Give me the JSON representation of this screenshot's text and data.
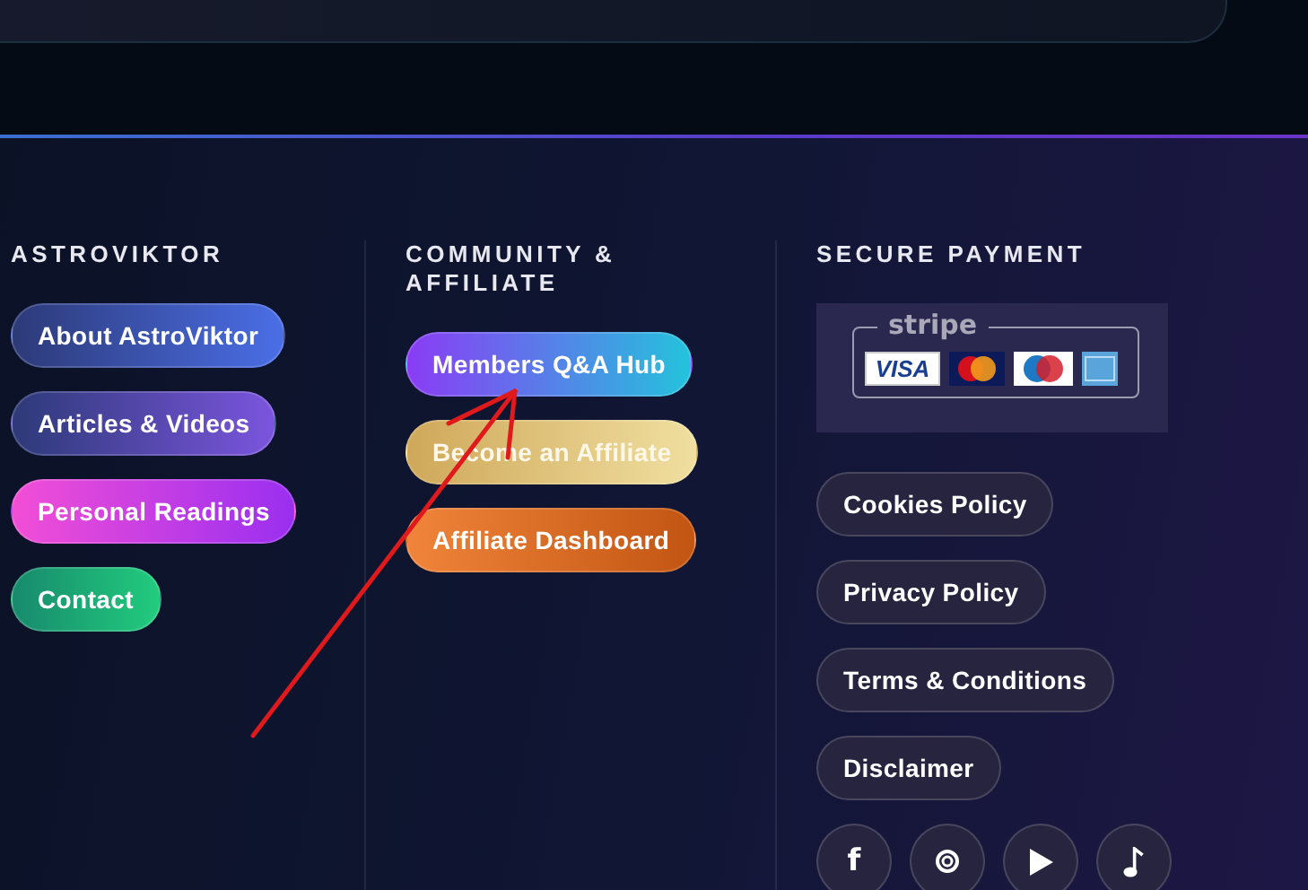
{
  "columns": [
    {
      "heading": "ASTROVIKTOR",
      "links": [
        {
          "label": "About AstroViktor",
          "kind": "blue"
        },
        {
          "label": "Articles & Videos",
          "kind": "violet"
        },
        {
          "label": "Personal Readings",
          "kind": "pink"
        },
        {
          "label": "Contact",
          "kind": "green"
        }
      ]
    },
    {
      "heading": "COMMUNITY & AFFILIATE",
      "links": [
        {
          "label": "Members Q&A Hub",
          "kind": "purple"
        },
        {
          "label": "Become an Affiliate",
          "kind": "gold"
        },
        {
          "label": "Affiliate Dashboard",
          "kind": "orange"
        }
      ]
    },
    {
      "heading": "SECURE PAYMENT",
      "payment": {
        "provider": "stripe",
        "cards": [
          {
            "kind": "visa",
            "label": "VISA"
          },
          {
            "kind": "mastercard"
          },
          {
            "kind": "maestro"
          },
          {
            "kind": "amex"
          }
        ]
      },
      "links": [
        {
          "label": "Cookies Policy",
          "kind": "plain"
        },
        {
          "label": "Privacy Policy",
          "kind": "plain"
        },
        {
          "label": "Terms & Conditions",
          "kind": "plain"
        },
        {
          "label": "Disclaimer",
          "kind": "plain"
        }
      ],
      "socials": [
        {
          "kind": "letter",
          "glyph": "f"
        },
        {
          "kind": "ring"
        },
        {
          "kind": "play"
        },
        {
          "kind": "note"
        }
      ]
    }
  ],
  "annotation": {
    "kind": "arrow"
  }
}
